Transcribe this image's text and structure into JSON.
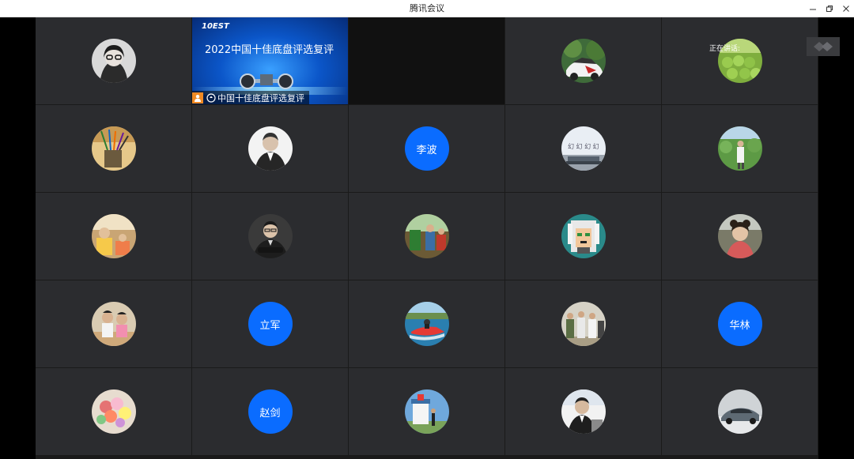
{
  "window": {
    "title": "腾讯会议",
    "controls": [
      "minimize-icon",
      "restore-icon",
      "close-icon"
    ]
  },
  "status": {
    "speaking_label": "正在讲话:"
  },
  "screen_share": {
    "logo_text": "10EST",
    "headline": "2022中国十佳底盘评选复评",
    "sharer_label": "中国十佳底盘评选复评"
  },
  "participants": [
    {
      "type": "photo",
      "icon": "woman-glasses-avatar"
    },
    {
      "type": "share"
    },
    {
      "type": "empty"
    },
    {
      "type": "photo",
      "icon": "car-avatar"
    },
    {
      "type": "photo",
      "icon": "fruit-avatar"
    },
    {
      "type": "photo",
      "icon": "pens-avatar"
    },
    {
      "type": "photo",
      "icon": "man-suit-avatar"
    },
    {
      "type": "name",
      "name": "李波"
    },
    {
      "type": "photo",
      "icon": "room-avatar"
    },
    {
      "type": "photo",
      "icon": "field-person-avatar"
    },
    {
      "type": "photo",
      "icon": "family-avatar"
    },
    {
      "type": "photo",
      "icon": "man-arms-crossed-avatar"
    },
    {
      "type": "photo",
      "icon": "room-people-avatar"
    },
    {
      "type": "photo",
      "icon": "pixel-art-avatar"
    },
    {
      "type": "photo",
      "icon": "girl-avatar"
    },
    {
      "type": "photo",
      "icon": "couple-avatar"
    },
    {
      "type": "name",
      "name": "立军"
    },
    {
      "type": "photo",
      "icon": "jetski-avatar"
    },
    {
      "type": "photo",
      "icon": "group-photo-avatar"
    },
    {
      "type": "name",
      "name": "华林"
    },
    {
      "type": "photo",
      "icon": "flowers-avatar"
    },
    {
      "type": "name",
      "name": "赵剑"
    },
    {
      "type": "photo",
      "icon": "lighthouse-avatar"
    },
    {
      "type": "photo",
      "icon": "speaker-avatar"
    },
    {
      "type": "photo",
      "icon": "sedan-avatar"
    }
  ],
  "colors": {
    "name_avatar": "#0a6cff",
    "tile": "#2b2c2f",
    "share_bg": "#0b56c9",
    "sharer_icon": "#f08a24"
  }
}
